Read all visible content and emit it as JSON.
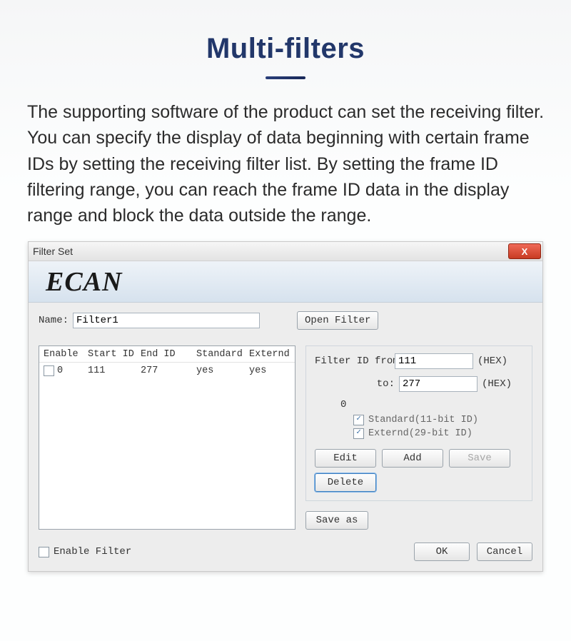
{
  "hero": {
    "title": "Multi-filters",
    "description": "The supporting software of the product can set the receiving filter. You can specify the display of data beginning with certain frame IDs by setting the receiving filter list. By setting the frame ID filtering range, you can reach the frame ID data in the display range and block the data outside the range."
  },
  "dialog": {
    "title": "Filter Set",
    "banner": "ECAN",
    "name_label": "Name:",
    "name_value": "Filter1",
    "open_filter_btn": "Open Filter",
    "columns": {
      "enable": "Enable",
      "start_id": "Start ID",
      "end_id": "End ID",
      "standard": "Standard",
      "externd": "Externd"
    },
    "rows": [
      {
        "idx": "0",
        "start": "111",
        "end": "277",
        "std": "yes",
        "ext": "yes",
        "checked": false
      }
    ],
    "side": {
      "from_label": "Filter ID from:",
      "from_value": "111",
      "to_label": "to:",
      "to_value": "277",
      "hex": "(HEX)",
      "zero": "0",
      "std_label": "Standard(11-bit ID)",
      "ext_label": "Externd(29-bit ID)",
      "edit_btn": "Edit",
      "add_btn": "Add",
      "save_btn": "Save",
      "delete_btn": "Delete"
    },
    "save_as_btn": "Save as",
    "enable_filter_label": "Enable Filter",
    "ok_btn": "OK",
    "cancel_btn": "Cancel"
  }
}
